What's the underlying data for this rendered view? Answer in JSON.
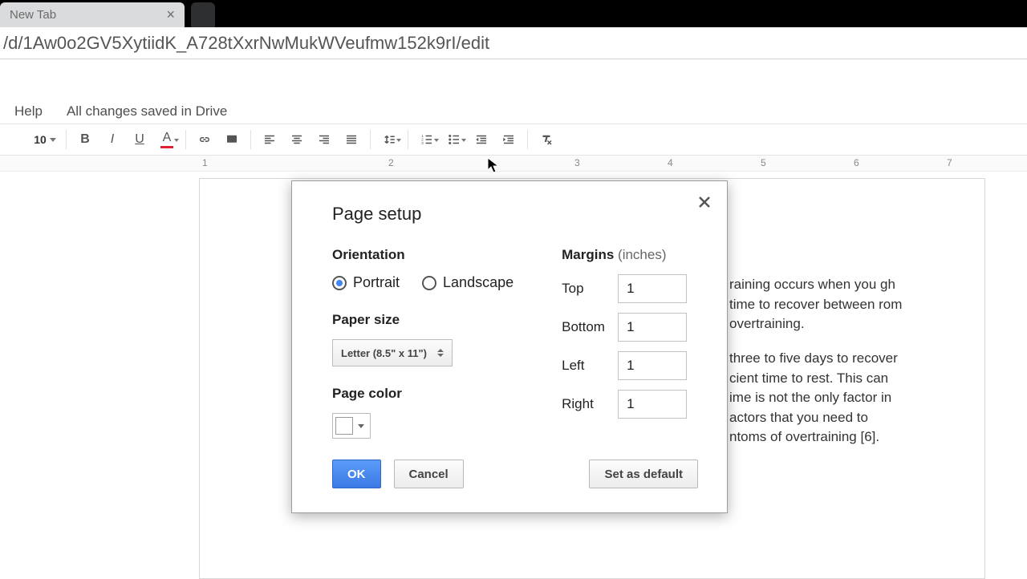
{
  "browser": {
    "tab_title": "New Tab",
    "url": "/d/1Aw0o2GV5XytiidK_A728tXxrNwMukWVeufmw152k9rI/edit"
  },
  "menu": {
    "help": "Help",
    "status": "All changes saved in Drive"
  },
  "toolbar": {
    "font_size": "10"
  },
  "ruler": {
    "ticks": [
      "1",
      "2",
      "3",
      "4",
      "5",
      "6",
      "7"
    ]
  },
  "dialog": {
    "title": "Page setup",
    "orientation_label": "Orientation",
    "portrait": "Portrait",
    "landscape": "Landscape",
    "paper_size_label": "Paper size",
    "paper_size_value": "Letter (8.5\" x 11\")",
    "page_color_label": "Page color",
    "margins_label": "Margins",
    "margins_unit": "(inches)",
    "top_label": "Top",
    "bottom_label": "Bottom",
    "left_label": "Left",
    "right_label": "Right",
    "top": "1",
    "bottom": "1",
    "left": "1",
    "right": "1",
    "ok": "OK",
    "cancel": "Cancel",
    "set_default": "Set as default"
  },
  "doc": {
    "p1": "raining occurs when you gh time to recover between rom overtraining.",
    "p2": "three to five days to recover cient time to rest. This can ime is not the only factor in actors that you need to ntoms of overtraining [6]."
  }
}
